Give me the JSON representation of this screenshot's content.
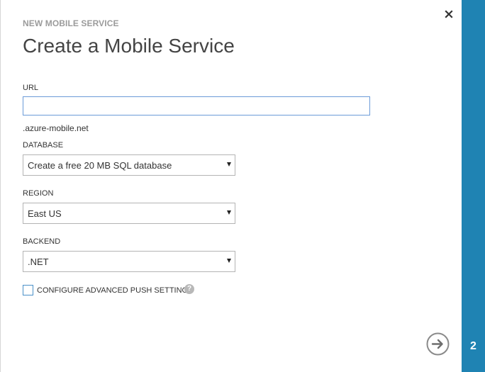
{
  "header": {
    "eyebrow": "NEW MOBILE SERVICE",
    "title": "Create a Mobile Service"
  },
  "url": {
    "label": "URL",
    "value": "",
    "suffix": ".azure-mobile.net"
  },
  "database": {
    "label": "DATABASE",
    "selected": "Create a free 20 MB SQL database"
  },
  "region": {
    "label": "REGION",
    "selected": "East US"
  },
  "backend": {
    "label": "BACKEND",
    "selected": ".NET"
  },
  "push": {
    "label": "CONFIGURE ADVANCED PUSH SETTINGS",
    "checked": false,
    "help_glyph": "?"
  },
  "wizard": {
    "step": "2"
  },
  "icons": {
    "close": "close-icon",
    "next": "arrow-right-circle-icon",
    "help": "help-icon",
    "dropdown": "chevron-down-icon"
  },
  "colors": {
    "accent": "#1f83b3",
    "input_focus_border": "#6b9bd8",
    "checkbox_border": "#4a90c8",
    "muted_text": "#9b9b9b"
  }
}
